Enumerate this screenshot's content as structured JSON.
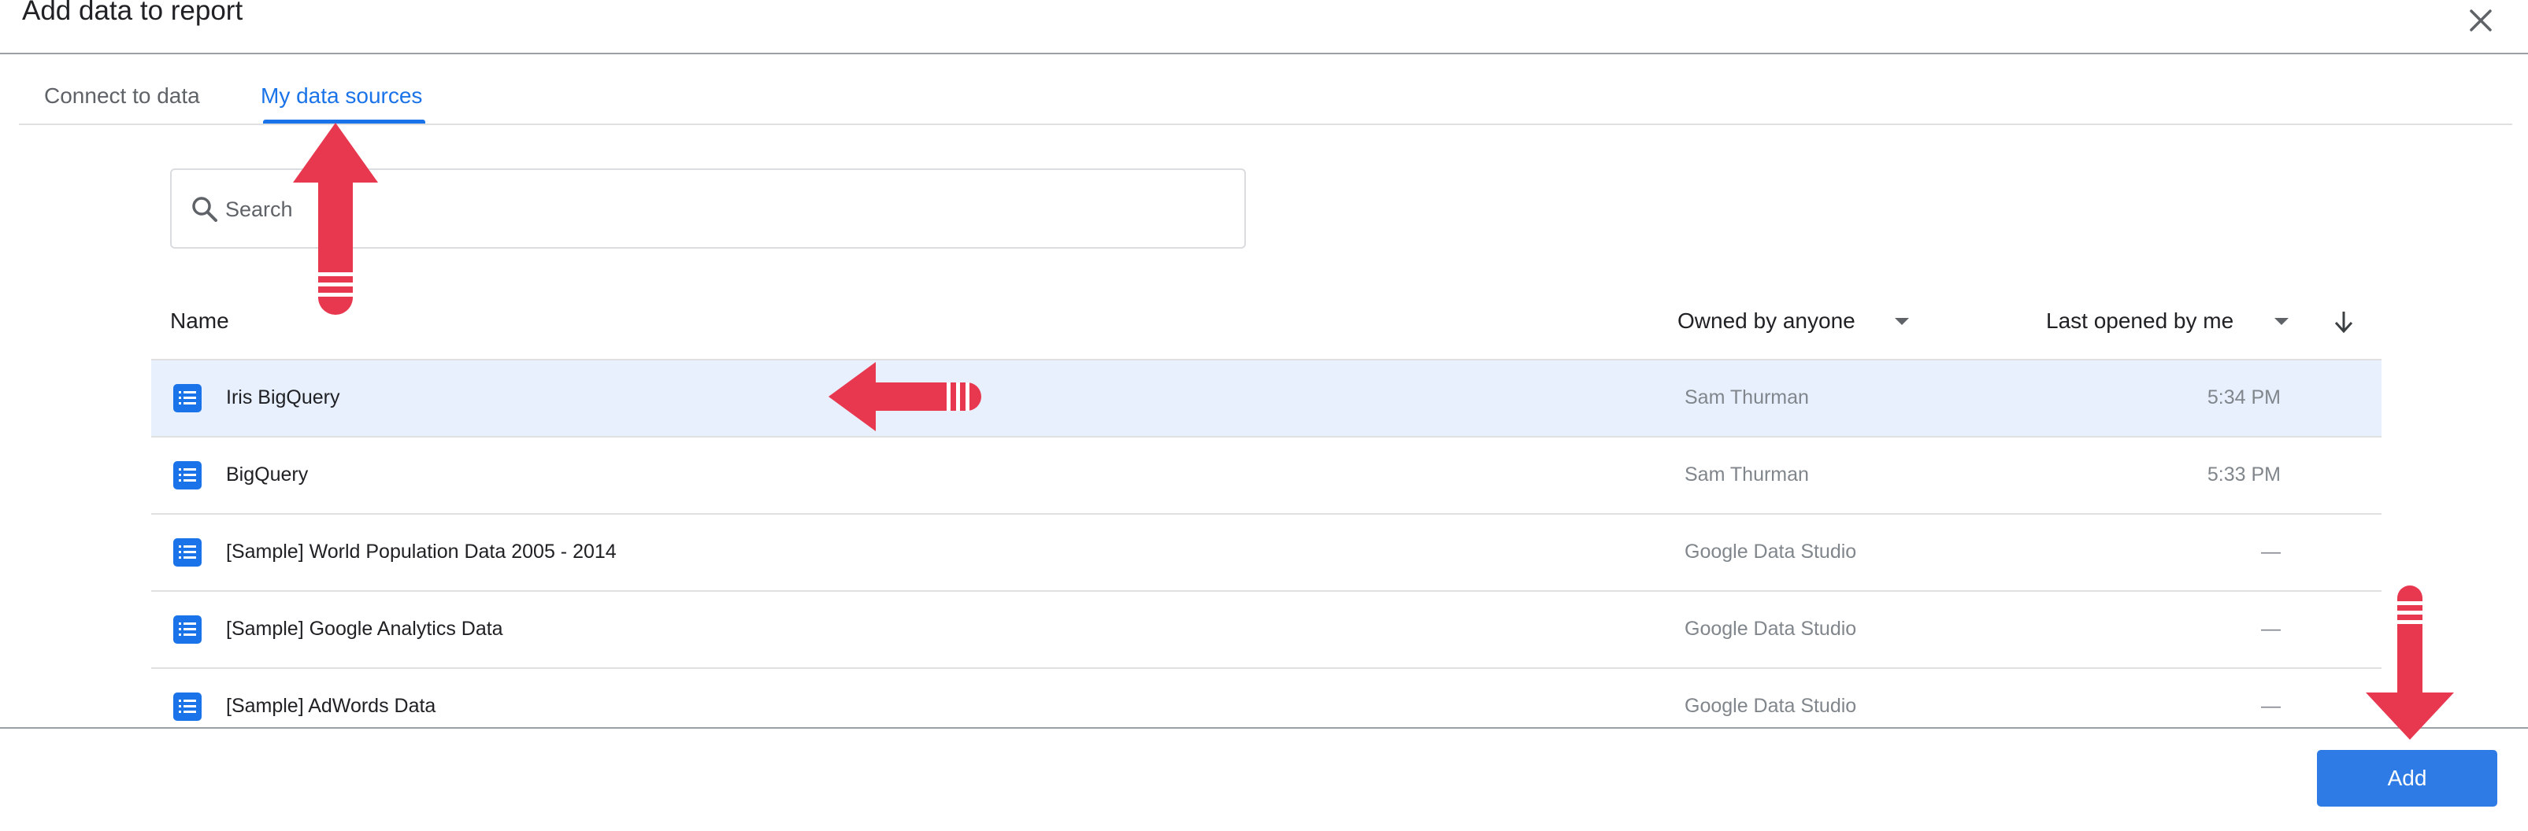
{
  "dialog": {
    "title": "Add data to report",
    "close_icon": "close-icon"
  },
  "tabs": [
    {
      "label": "Connect to data",
      "active": false
    },
    {
      "label": "My data sources",
      "active": true
    }
  ],
  "search": {
    "placeholder": "Search",
    "value": "",
    "icon": "search-icon"
  },
  "table": {
    "columns": {
      "name": "Name",
      "owner_filter": "Owned by anyone",
      "sort_filter": "Last opened by me",
      "sort_icon": "arrow-down-icon"
    },
    "rows": [
      {
        "name": "Iris BigQuery",
        "owner": "Sam Thurman",
        "last_opened": "5:34 PM",
        "selected": true
      },
      {
        "name": "BigQuery",
        "owner": "Sam Thurman",
        "last_opened": "5:33 PM",
        "selected": false
      },
      {
        "name": "[Sample] World Population Data 2005 - 2014",
        "owner": "Google Data Studio",
        "last_opened": "—",
        "selected": false
      },
      {
        "name": "[Sample] Google Analytics Data",
        "owner": "Google Data Studio",
        "last_opened": "—",
        "selected": false
      },
      {
        "name": "[Sample] AdWords Data",
        "owner": "Google Data Studio",
        "last_opened": "—",
        "selected": false
      }
    ]
  },
  "footer": {
    "add_label": "Add"
  },
  "colors": {
    "accent": "#1a73e8",
    "selected_row": "#e8f0fe",
    "annotation_arrow": "#e8384f"
  }
}
